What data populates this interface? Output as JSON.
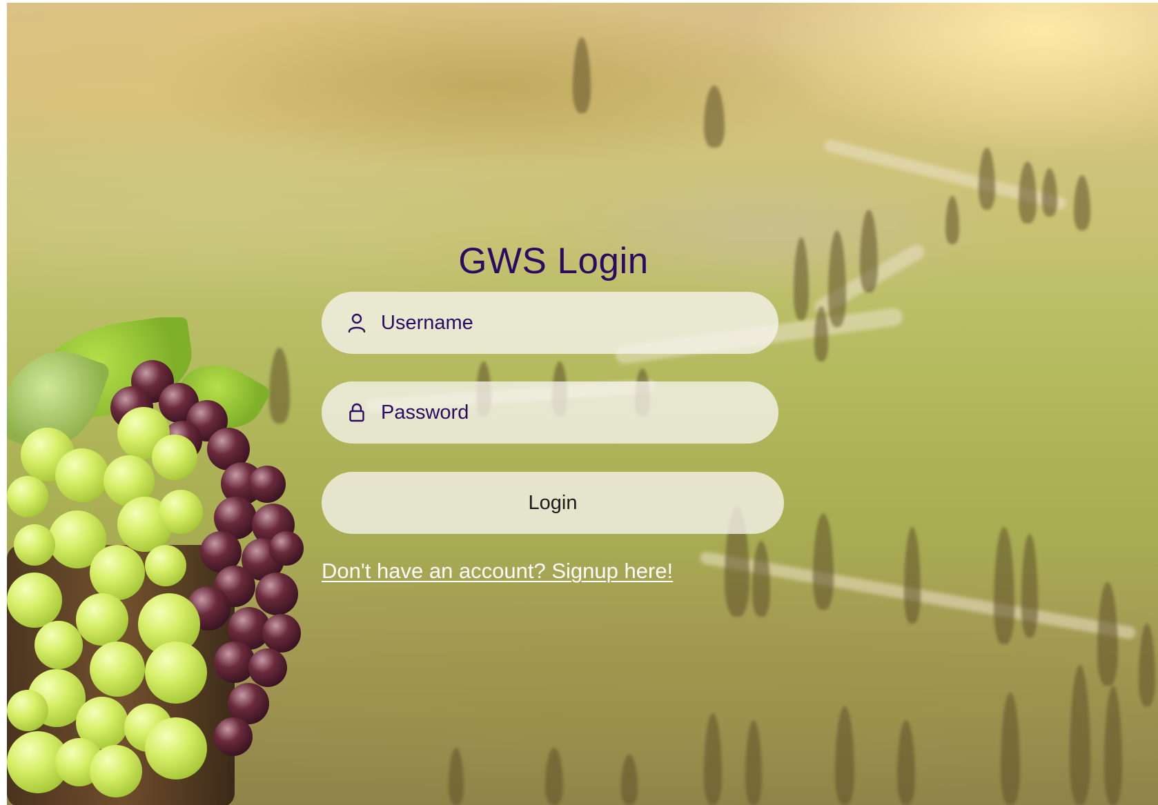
{
  "page": {
    "title": "GWS Login"
  },
  "form": {
    "username_placeholder": "Username",
    "password_placeholder": "Password",
    "username_icon": "user-icon",
    "password_icon": "lock-icon",
    "login_label": "Login",
    "signup_text": "Don't have an account? Signup here!"
  },
  "colors": {
    "title": "#2a0a63",
    "input_background": "#f6f4ee",
    "link": "#ffffff"
  }
}
